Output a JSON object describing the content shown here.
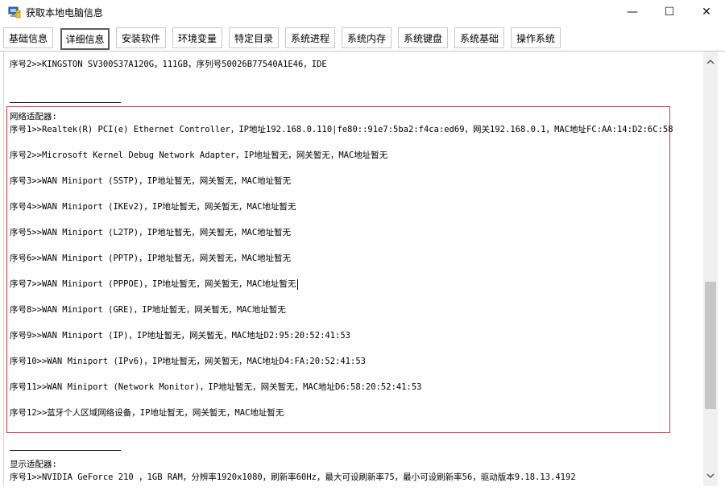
{
  "window": {
    "title": "获取本地电脑信息",
    "minimize_label": "—",
    "maximize_label": "☐",
    "close_label": "✕"
  },
  "tabs": [
    {
      "label": "基础信息"
    },
    {
      "label": "详细信息"
    },
    {
      "label": "安装软件"
    },
    {
      "label": "环境变量"
    },
    {
      "label": "特定目录"
    },
    {
      "label": "系统进程"
    },
    {
      "label": "系统内存"
    },
    {
      "label": "系统键盘"
    },
    {
      "label": "系统基础"
    },
    {
      "label": "操作系统"
    }
  ],
  "active_tab": "详细信息",
  "content": {
    "disk_line": "序号2>>KINGSTON SV300S37A120G，111GB，序列号50026B77540A1E46，IDE",
    "network_header": "网络适配器:",
    "network_lines": [
      "序号1>>Realtek(R) PCI(e) Ethernet Controller，IP地址192.168.0.110|fe80::91e7:5ba2:f4ca:ed69，网关192.168.0.1，MAC地址FC:AA:14:D2:6C:58",
      "序号2>>Microsoft Kernel Debug Network Adapter，IP地址暂无，网关暂无，MAC地址暂无",
      "序号3>>WAN Miniport (SSTP)，IP地址暂无，网关暂无，MAC地址暂无",
      "序号4>>WAN Miniport (IKEv2)，IP地址暂无，网关暂无，MAC地址暂无",
      "序号5>>WAN Miniport (L2TP)，IP地址暂无，网关暂无，MAC地址暂无",
      "序号6>>WAN Miniport (PPTP)，IP地址暂无，网关暂无，MAC地址暂无",
      "序号7>>WAN Miniport (PPPOE)，IP地址暂无，网关暂无，MAC地址暂无",
      "序号8>>WAN Miniport (GRE)，IP地址暂无，网关暂无，MAC地址暂无",
      "序号9>>WAN Miniport (IP)，IP地址暂无，网关暂无，MAC地址D2:95:20:52:41:53",
      "序号10>>WAN Miniport (IPv6)，IP地址暂无，网关暂无，MAC地址D4:FA:20:52:41:53",
      "序号11>>WAN Miniport (Network Monitor)，IP地址暂无，网关暂无，MAC地址D6:58:20:52:41:53",
      "序号12>>蓝牙个人区域网络设备，IP地址暂无，网关暂无，MAC地址暂无"
    ],
    "display_header": "显示适配器:",
    "display_line": "序号1>>NVIDIA GeForce 210 ，1GB RAM，分辨率1920x1080，刷新率60Hz，最大可设刷新率75，最小可设刷新率56，驱动版本9.18.13.4192"
  },
  "colors": {
    "highlight_border": "#e0353a",
    "active_tab_border": "#5a5a5a"
  },
  "icons": {
    "app": "computer-icon",
    "scroll_up": "chevron-up-icon",
    "scroll_down": "chevron-down-icon"
  }
}
